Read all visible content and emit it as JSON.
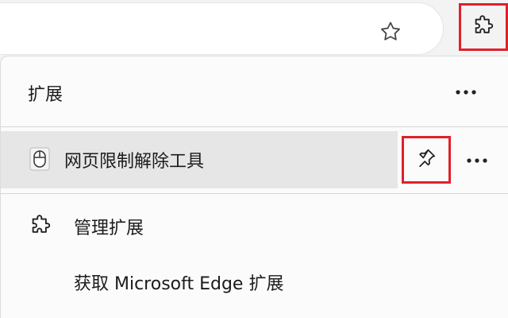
{
  "toolbar": {
    "favorite_icon": "star-outline-icon",
    "extensions_icon": "puzzle-piece-icon",
    "highlight_color": "#e0202a"
  },
  "menu": {
    "title": "扩展",
    "more_icon": "more-horizontal-icon",
    "extension_item": {
      "name": "网页限制解除工具",
      "icon": "mouse-icon",
      "pin_icon": "pin-icon",
      "more_icon": "more-horizontal-icon"
    },
    "manage_label": "管理扩展",
    "manage_icon": "puzzle-piece-icon",
    "get_extensions_label": "获取 Microsoft Edge 扩展"
  }
}
